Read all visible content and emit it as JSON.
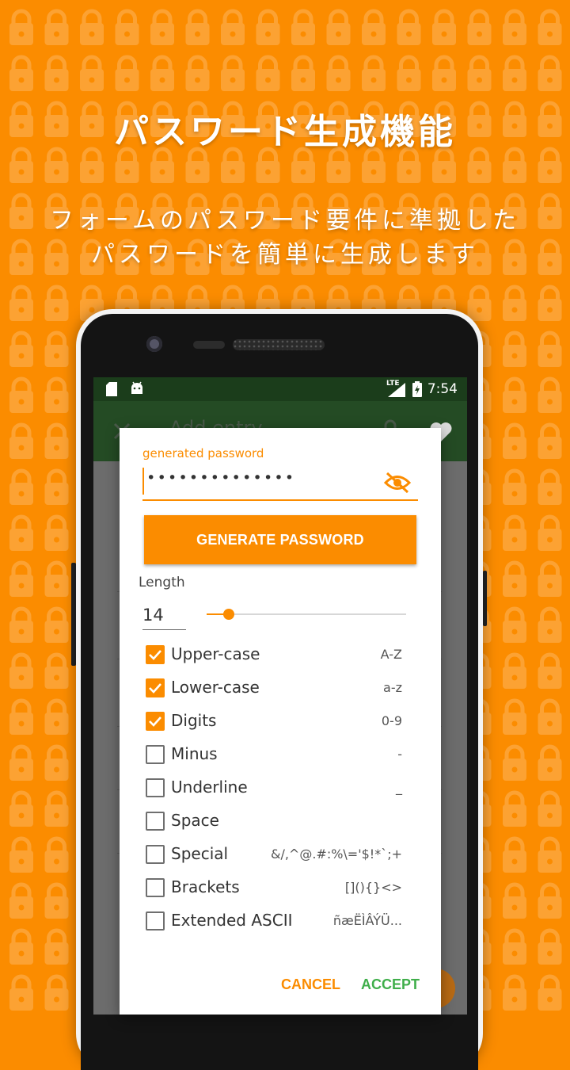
{
  "colors": {
    "background": "#fb8c00",
    "accent": "#fb8c00",
    "accept": "#3fae4a"
  },
  "promo": {
    "title": "パスワード生成機能",
    "subtitle_line1": "フォームのパスワード要件に準拠した",
    "subtitle_line2": "パスワードを簡単に生成します"
  },
  "status_bar": {
    "time": "7:54",
    "network": "LTE",
    "icons": [
      "sd-card-icon",
      "android-icon",
      "signal-icon",
      "battery-charging-icon"
    ]
  },
  "app_bar": {
    "title": "Add entry",
    "icons": [
      "close-icon",
      "lock-icon",
      "heart-icon"
    ]
  },
  "dialog": {
    "field_label": "generated password",
    "password_mask": "••••••••••••••",
    "visibility_icon": "visibility-off-icon",
    "generate_button": "GENERATE PASSWORD",
    "length_label": "Length",
    "length_value": "14",
    "length_slider_fraction": 0.11,
    "options": [
      {
        "label": "Upper-case",
        "chars": "A-Z",
        "checked": true
      },
      {
        "label": "Lower-case",
        "chars": "a-z",
        "checked": true
      },
      {
        "label": "Digits",
        "chars": "0-9",
        "checked": true
      },
      {
        "label": "Minus",
        "chars": "-",
        "checked": false
      },
      {
        "label": "Underline",
        "chars": "_",
        "checked": false
      },
      {
        "label": "Space",
        "chars": "",
        "checked": false
      },
      {
        "label": "Special",
        "chars": "&/,^@.#:%\\='$!*`;+",
        "checked": false
      },
      {
        "label": "Brackets",
        "chars": "[](){}<>",
        "checked": false
      },
      {
        "label": "Extended ASCII",
        "chars": "ñæËÌÂÝÜ...",
        "checked": false
      }
    ],
    "cancel_button": "CANCEL",
    "accept_button": "ACCEPT"
  }
}
